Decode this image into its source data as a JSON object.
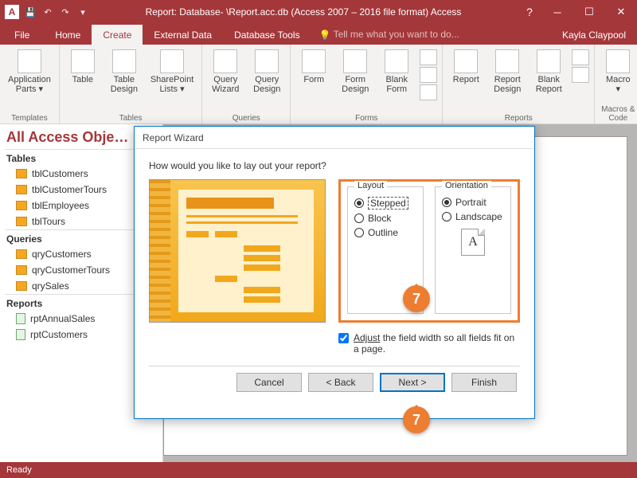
{
  "titlebar": {
    "title": "Report: Database- \\Report.acc.db (Access 2007 – 2016 file format) Access",
    "help": "?"
  },
  "tabs": {
    "file": "File",
    "home": "Home",
    "create": "Create",
    "external": "External Data",
    "dbtools": "Database Tools",
    "tellme": "Tell me what you want to do..."
  },
  "user": "Kayla Claypool",
  "ribbon": {
    "templates": {
      "label": "Templates",
      "appparts": "Application\nParts ▾"
    },
    "tables": {
      "label": "Tables",
      "table": "Table",
      "tdesign": "Table\nDesign",
      "sp": "SharePoint\nLists ▾"
    },
    "queries": {
      "label": "Queries",
      "qw": "Query\nWizard",
      "qd": "Query\nDesign"
    },
    "forms": {
      "label": "Forms",
      "form": "Form",
      "fd": "Form\nDesign",
      "bf": "Blank\nForm"
    },
    "reports": {
      "label": "Reports",
      "rpt": "Report",
      "rd": "Report\nDesign",
      "br": "Blank\nReport"
    },
    "macros": {
      "label": "Macros & Code",
      "macro": "Macro\n▾"
    }
  },
  "nav": {
    "title": "All Access Obje…",
    "sections": {
      "tables": "Tables",
      "queries": "Queries",
      "reports": "Reports"
    },
    "tables": [
      "tblCustomers",
      "tblCustomerTours",
      "tblEmployees",
      "tblTours"
    ],
    "queries": [
      "qryCustomers",
      "qryCustomerTours",
      "qrySales"
    ],
    "reports": [
      "rptAnnualSales",
      "rptCustomers"
    ]
  },
  "dialog": {
    "title": "Report Wizard",
    "question": "How would you like to lay out your report?",
    "layout_legend": "Layout",
    "layout": {
      "stepped": "Stepped",
      "block": "Block",
      "outline": "Outline"
    },
    "orient_legend": "Orientation",
    "orient": {
      "portrait": "Portrait",
      "landscape": "Landscape"
    },
    "orient_preview": "A",
    "adjust_pre": "Adjust",
    "adjust_rest": " the field width so all fields fit on a page.",
    "buttons": {
      "cancel": "Cancel",
      "back": "< Back",
      "next": "Next >",
      "finish": "Finish"
    }
  },
  "callout": "7",
  "status": "Ready"
}
